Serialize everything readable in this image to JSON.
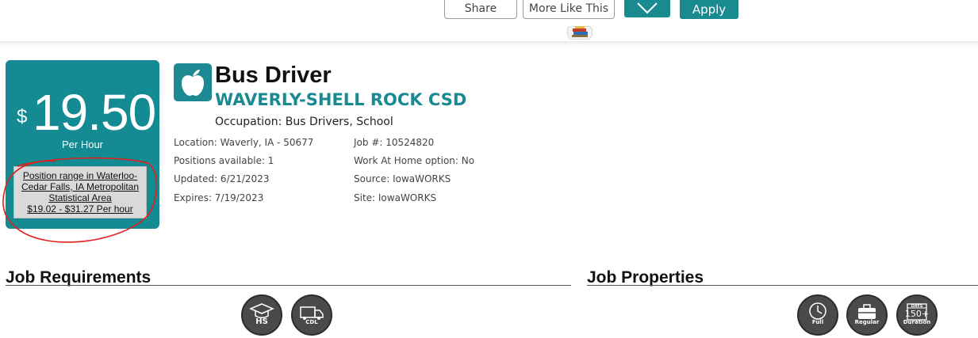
{
  "toolbar": {
    "share_label": "Share",
    "more_like_this_label": "More Like This",
    "apply_label": "Apply"
  },
  "wage": {
    "currency": "$",
    "amount": "19.50",
    "unit": "Per Hour",
    "range_line1": "Position range in Waterloo-",
    "range_line2": "Cedar Falls, IA Metropolitan",
    "range_line3": "Statistical Area",
    "range_line4": "$19.02 - $31.27 Per hour"
  },
  "job": {
    "title": "Bus Driver",
    "employer": "WAVERLY-SHELL ROCK CSD",
    "occupation": "Occupation: Bus Drivers, School",
    "location": "Location: Waverly, IA - 50677",
    "positions": "Positions available: 1",
    "updated": "Updated: 6/21/2023",
    "expires": "Expires: 7/19/2023",
    "job_number": "Job #: 10524820",
    "work_at_home": "Work At Home option: No",
    "source": "Source: IowaWORKS",
    "site": "Site: IowaWORKS"
  },
  "requirements": {
    "title": "Job Requirements",
    "icons": [
      {
        "name": "high-school-icon",
        "label": "HS"
      },
      {
        "name": "cdl-truck-icon",
        "label": "CDL"
      }
    ]
  },
  "properties": {
    "title": "Job Properties",
    "icons": [
      {
        "name": "full-time-clock-icon",
        "label": "Full"
      },
      {
        "name": "regular-briefcase-icon",
        "label": "Regular"
      },
      {
        "name": "duration-calendar-icon",
        "label": "Duration",
        "badge_top": "DAYS",
        "badge_value": "150+"
      }
    ]
  },
  "colors": {
    "brand_teal": "#148a93",
    "annotation_red": "#e0201b"
  }
}
